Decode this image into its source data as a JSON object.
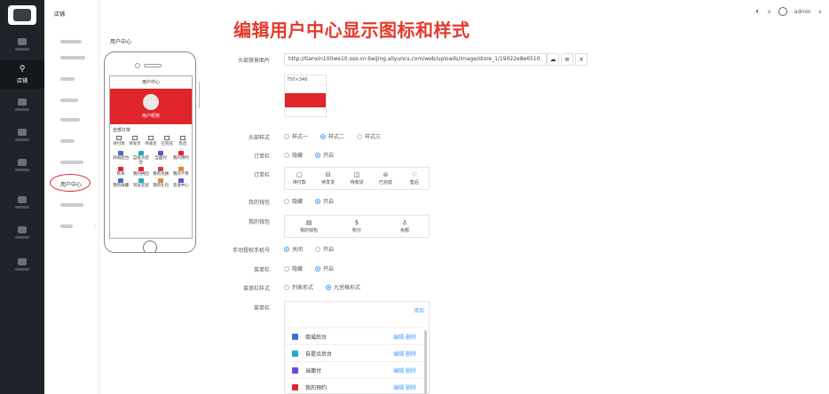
{
  "header": {
    "store_name": "店铺",
    "user_name": "admin",
    "chevron": "∨",
    "speaker_icon": "speaker-icon"
  },
  "rail": {
    "active_label": "店铺"
  },
  "sidebar": {
    "current_item": "用户中心"
  },
  "annotation": {
    "headline": "编辑用户中心显示图标和样式"
  },
  "page": {
    "label": "用户中心"
  },
  "preview": {
    "title": "用户中心",
    "user_name": "用户昵称",
    "order_header": "全部订单",
    "order_items": [
      "待付款",
      "待发货",
      "待收货",
      "已完成",
      "售后"
    ],
    "grid_items": [
      {
        "label": "商城后台",
        "color": "#3b6fd6"
      },
      {
        "label": "自提点后台",
        "color": "#27a7c9"
      },
      {
        "label": "当面付",
        "color": "#6a4bd6"
      },
      {
        "label": "我的预约",
        "color": "#e0252b"
      },
      {
        "label": "秒杀",
        "color": "#e0252b"
      },
      {
        "label": "我的拼团",
        "color": "#e0252b"
      },
      {
        "label": "我的兑换",
        "color": "#d63b3b"
      },
      {
        "label": "我的卡券",
        "color": "#e08a25"
      },
      {
        "label": "我的收藏",
        "color": "#3b6fd6"
      },
      {
        "label": "浏览足迹",
        "color": "#27a7c9"
      },
      {
        "label": "我的礼包",
        "color": "#e08a25"
      },
      {
        "label": "充值中心",
        "color": "#6a4bd6"
      }
    ]
  },
  "form": {
    "bg_image": {
      "label": "头部背景图片",
      "url": "http://tianxin100we10.oss-cn-beijing.aliyuncs.com/web/uploads/image/store_1/19022e8e6510",
      "size_hint": "750×348",
      "upload_icon": "☁",
      "list_icon": "≡",
      "clear_icon": "×"
    },
    "header_style": {
      "label": "头部样式",
      "options": [
        "样式一",
        "样式二",
        "样式三"
      ],
      "selected": 1
    },
    "order_bar": {
      "label": "订单栏",
      "options": [
        "隐藏",
        "开启"
      ],
      "selected": 1
    },
    "order_icons": {
      "label": "订单栏",
      "items": [
        {
          "glyph": "▢",
          "label": "待付款"
        },
        {
          "glyph": "⊟",
          "label": "待发货"
        },
        {
          "glyph": "◫",
          "label": "待收货"
        },
        {
          "glyph": "⊜",
          "label": "已完成"
        },
        {
          "glyph": "♡",
          "label": "售后"
        }
      ]
    },
    "wallet": {
      "label": "我的钱包",
      "options": [
        "隐藏",
        "开启"
      ],
      "selected": 1
    },
    "wallet_icons": {
      "label": "我的钱包",
      "items": [
        {
          "glyph": "▤",
          "label": "我的钱包"
        },
        {
          "glyph": "$",
          "label": "积分"
        },
        {
          "glyph": "♙",
          "label": "余额"
        }
      ]
    },
    "phone_auth": {
      "label": "手动授权手机号",
      "options": [
        "关闭",
        "开启"
      ],
      "selected": 0
    },
    "menu_bar": {
      "label": "菜单栏",
      "options": [
        "隐藏",
        "开启"
      ],
      "selected": 1
    },
    "menu_style": {
      "label": "菜单栏样式",
      "options": [
        "列表形式",
        "九宫格形式"
      ],
      "selected": 1
    },
    "menu_list": {
      "label": "菜单栏",
      "add_label": "添加",
      "edit_label": "编辑",
      "delete_label": "删除",
      "items": [
        {
          "label": "商城后台",
          "color": "#3b6fd6"
        },
        {
          "label": "自提点后台",
          "color": "#27a7c9"
        },
        {
          "label": "当面付",
          "color": "#6a4bd6"
        },
        {
          "label": "我的预约",
          "color": "#e0252b"
        }
      ]
    }
  }
}
